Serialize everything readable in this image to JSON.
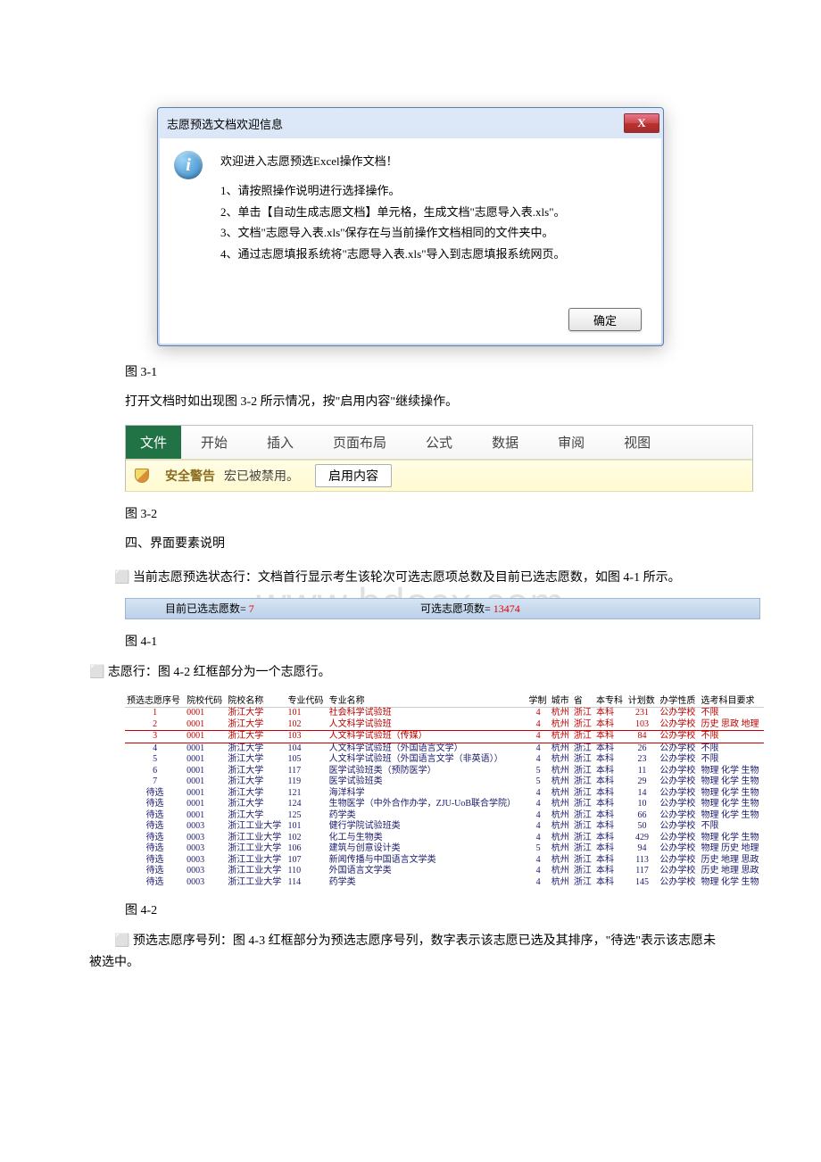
{
  "dialog": {
    "title": "志愿预选文档欢迎信息",
    "close_x": "X",
    "welcome": "欢迎进入志愿预选Excel操作文档！",
    "lines": [
      "1、请按照操作说明进行选择操作。",
      "2、单击【自动生成志愿文档】单元格，生成文档\"志愿导入表.xls\"。",
      "3、文档\"志愿导入表.xls\"保存在与当前操作文档相同的文件夹中。",
      "4、通过志愿填报系统将\"志愿导入表.xls\"导入到志愿填报系统网页。"
    ],
    "ok": "确定"
  },
  "text": {
    "fig31": "图 3-1",
    "para31": "打开文档时如出现图 3-2 所示情况，按\"启用内容\"继续操作。",
    "fig32": "图 3-2",
    "sec4title": "四、界面要素说明",
    "sec4a": "⬜ 当前志愿预选状态行：文档首行显示考生该轮次可选志愿项总数及目前已选志愿数，如图 4-1 所示。",
    "fig41": "图 4-1",
    "sec4b": "⬜ 志愿行：图 4-2 红框部分为一个志愿行。",
    "fig42": "图 4-2",
    "sec4c": "⬜ 预选志愿序号列：图 4-3 红框部分为预选志愿序号列，数字表示该志愿已选及其排序，\"待选\"表示该志愿未被选中。"
  },
  "excel": {
    "tabs": [
      "文件",
      "开始",
      "插入",
      "页面布局",
      "公式",
      "数据",
      "审阅",
      "视图"
    ],
    "sec_bold": "安全警告",
    "sec_text": "宏已被禁用。",
    "sec_btn": "启用内容"
  },
  "watermark": "www.bdocx.com",
  "status": {
    "left_label": "目前已选志愿数= ",
    "left_num": "7",
    "right_label": "可选志愿项数= ",
    "right_num": "13474"
  },
  "table": {
    "headers": [
      "预选志愿序号",
      "院校代码",
      "院校名称",
      "专业代码",
      "专业名称",
      "学制",
      "城市",
      "省",
      "本专科",
      "计划数",
      "办学性质",
      "选考科目要求"
    ],
    "rows": [
      {
        "n": "1",
        "redtext": true,
        "c1": "0001",
        "c2": "浙江大学",
        "c3": "101",
        "c4": "社会科学试验班",
        "c5": "4",
        "c6": "杭州",
        "c7": "浙江",
        "c8": "本科",
        "c9": "231",
        "c10": "公办学校",
        "c11": "不限"
      },
      {
        "n": "2",
        "redtext": true,
        "c1": "0001",
        "c2": "浙江大学",
        "c3": "102",
        "c4": "人文科学试验班",
        "c5": "4",
        "c6": "杭州",
        "c7": "浙江",
        "c8": "本科",
        "c9": "103",
        "c10": "公办学校",
        "c11": "历史 思政 地理"
      },
      {
        "n": "3",
        "redbox": true,
        "c1": "0001",
        "c2": "浙江大学",
        "c3": "103",
        "c4": "人文科学试验班（传媒）",
        "c5": "4",
        "c6": "杭州",
        "c7": "浙江",
        "c8": "本科",
        "c9": "84",
        "c10": "公办学校",
        "c11": "不限"
      },
      {
        "n": "4",
        "c1": "0001",
        "c2": "浙江大学",
        "c3": "104",
        "c4": "人文科学试验班（外国语言文学）",
        "c5": "4",
        "c6": "杭州",
        "c7": "浙江",
        "c8": "本科",
        "c9": "26",
        "c10": "公办学校",
        "c11": "不限"
      },
      {
        "n": "5",
        "c1": "0001",
        "c2": "浙江大学",
        "c3": "105",
        "c4": "人文科学试验班（外国语言文学（非英语））",
        "c5": "4",
        "c6": "杭州",
        "c7": "浙江",
        "c8": "本科",
        "c9": "23",
        "c10": "公办学校",
        "c11": "不限"
      },
      {
        "n": "6",
        "c1": "0001",
        "c2": "浙江大学",
        "c3": "117",
        "c4": "医学试验班类（预防医学）",
        "c5": "5",
        "c6": "杭州",
        "c7": "浙江",
        "c8": "本科",
        "c9": "11",
        "c10": "公办学校",
        "c11": "物理 化学 生物"
      },
      {
        "n": "7",
        "c1": "0001",
        "c2": "浙江大学",
        "c3": "119",
        "c4": "医学试验班类",
        "c5": "5",
        "c6": "杭州",
        "c7": "浙江",
        "c8": "本科",
        "c9": "29",
        "c10": "公办学校",
        "c11": "物理 化学 生物"
      },
      {
        "n": "待选",
        "c1": "0001",
        "c2": "浙江大学",
        "c3": "121",
        "c4": "海洋科学",
        "c5": "4",
        "c6": "杭州",
        "c7": "浙江",
        "c8": "本科",
        "c9": "14",
        "c10": "公办学校",
        "c11": "物理 化学 生物"
      },
      {
        "n": "待选",
        "c1": "0001",
        "c2": "浙江大学",
        "c3": "124",
        "c4": "生物医学（中外合作办学，ZJU-UoB联合学院）",
        "c5": "4",
        "c6": "杭州",
        "c7": "浙江",
        "c8": "本科",
        "c9": "10",
        "c10": "公办学校",
        "c11": "物理 化学 生物"
      },
      {
        "n": "待选",
        "c1": "0001",
        "c2": "浙江大学",
        "c3": "125",
        "c4": "药学类",
        "c5": "4",
        "c6": "杭州",
        "c7": "浙江",
        "c8": "本科",
        "c9": "66",
        "c10": "公办学校",
        "c11": "物理 化学 生物"
      },
      {
        "n": "待选",
        "c1": "0003",
        "c2": "浙江工业大学",
        "c3": "101",
        "c4": "健行学院试验班类",
        "c5": "4",
        "c6": "杭州",
        "c7": "浙江",
        "c8": "本科",
        "c9": "50",
        "c10": "公办学校",
        "c11": "不限"
      },
      {
        "n": "待选",
        "c1": "0003",
        "c2": "浙江工业大学",
        "c3": "102",
        "c4": "化工与生物类",
        "c5": "4",
        "c6": "杭州",
        "c7": "浙江",
        "c8": "本科",
        "c9": "429",
        "c10": "公办学校",
        "c11": "物理 化学 生物"
      },
      {
        "n": "待选",
        "c1": "0003",
        "c2": "浙江工业大学",
        "c3": "106",
        "c4": "建筑与创意设计类",
        "c5": "5",
        "c6": "杭州",
        "c7": "浙江",
        "c8": "本科",
        "c9": "94",
        "c10": "公办学校",
        "c11": "物理 历史 地理"
      },
      {
        "n": "待选",
        "c1": "0003",
        "c2": "浙江工业大学",
        "c3": "107",
        "c4": "新闻传播与中国语言文学类",
        "c5": "4",
        "c6": "杭州",
        "c7": "浙江",
        "c8": "本科",
        "c9": "113",
        "c10": "公办学校",
        "c11": "历史 地理 思政"
      },
      {
        "n": "待选",
        "c1": "0003",
        "c2": "浙江工业大学",
        "c3": "110",
        "c4": "外国语言文学类",
        "c5": "4",
        "c6": "杭州",
        "c7": "浙江",
        "c8": "本科",
        "c9": "117",
        "c10": "公办学校",
        "c11": "历史 地理 思政"
      },
      {
        "n": "待选",
        "c1": "0003",
        "c2": "浙江工业大学",
        "c3": "114",
        "c4": "药学类",
        "c5": "4",
        "c6": "杭州",
        "c7": "浙江",
        "c8": "本科",
        "c9": "145",
        "c10": "公办学校",
        "c11": "物理 化学 生物"
      }
    ]
  }
}
